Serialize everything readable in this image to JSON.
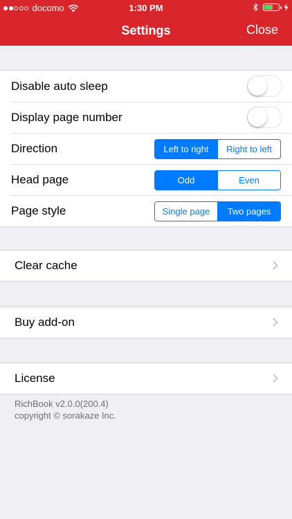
{
  "status_bar": {
    "carrier": "docomo",
    "time": "1:30 PM",
    "signal_dots_filled": 2,
    "signal_dots_total": 5,
    "battery_level": 0.6,
    "icons": [
      "wifi-icon",
      "bluetooth-icon",
      "battery-icon",
      "charging-bolt-icon"
    ],
    "colors": {
      "battery_fill": "#4cd964"
    }
  },
  "nav": {
    "title": "Settings",
    "close_label": "Close"
  },
  "settings": {
    "disable_auto_sleep": {
      "label": "Disable auto sleep",
      "on": false
    },
    "display_page_number": {
      "label": "Display page number",
      "on": false
    },
    "direction": {
      "label": "Direction",
      "options": [
        "Left to right",
        "Right to left"
      ],
      "selected": "Left to right"
    },
    "head_page": {
      "label": "Head page",
      "options": [
        "Odd",
        "Even"
      ],
      "selected": "Odd"
    },
    "page_style": {
      "label": "Page style",
      "options": [
        "Single page",
        "Two pages"
      ],
      "selected": "Two pages"
    }
  },
  "actions": {
    "clear_cache": "Clear cache",
    "buy_addon": "Buy add-on",
    "license": "License"
  },
  "footer": {
    "version": "RichBook v2.0.0(200.4)",
    "copyright": "copyright © sorakaze Inc."
  },
  "colors": {
    "brand_red": "#d8262c",
    "accent_blue": "#007aff",
    "background": "#efeff4"
  }
}
